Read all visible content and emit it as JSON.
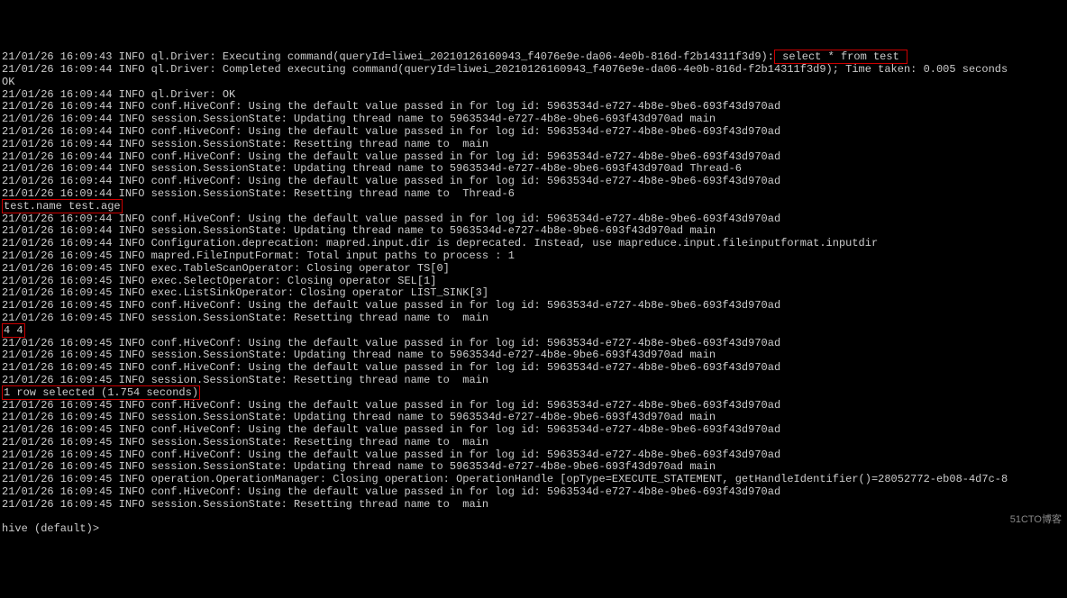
{
  "lines": [
    {
      "type": "mixed",
      "prefix": "21/01/26 16:09:43 INFO ql.Driver: Executing command(queryId=liwei_20210126160943_f4076e9e-da06-4e0b-816d-f2b14311f3d9):",
      "highlighted": " select * from test "
    },
    {
      "type": "plain",
      "text": "21/01/26 16:09:44 INFO ql.Driver: Completed executing command(queryId=liwei_20210126160943_f4076e9e-da06-4e0b-816d-f2b14311f3d9); Time taken: 0.005 seconds"
    },
    {
      "type": "plain",
      "text": "OK"
    },
    {
      "type": "plain",
      "text": "21/01/26 16:09:44 INFO ql.Driver: OK"
    },
    {
      "type": "plain",
      "text": "21/01/26 16:09:44 INFO conf.HiveConf: Using the default value passed in for log id: 5963534d-e727-4b8e-9be6-693f43d970ad"
    },
    {
      "type": "plain",
      "text": "21/01/26 16:09:44 INFO session.SessionState: Updating thread name to 5963534d-e727-4b8e-9be6-693f43d970ad main"
    },
    {
      "type": "plain",
      "text": "21/01/26 16:09:44 INFO conf.HiveConf: Using the default value passed in for log id: 5963534d-e727-4b8e-9be6-693f43d970ad"
    },
    {
      "type": "plain",
      "text": "21/01/26 16:09:44 INFO session.SessionState: Resetting thread name to  main"
    },
    {
      "type": "plain",
      "text": "21/01/26 16:09:44 INFO conf.HiveConf: Using the default value passed in for log id: 5963534d-e727-4b8e-9be6-693f43d970ad"
    },
    {
      "type": "plain",
      "text": "21/01/26 16:09:44 INFO session.SessionState: Updating thread name to 5963534d-e727-4b8e-9be6-693f43d970ad Thread-6"
    },
    {
      "type": "plain",
      "text": "21/01/26 16:09:44 INFO conf.HiveConf: Using the default value passed in for log id: 5963534d-e727-4b8e-9be6-693f43d970ad"
    },
    {
      "type": "plain",
      "text": "21/01/26 16:09:44 INFO session.SessionState: Resetting thread name to  Thread-6"
    },
    {
      "type": "highlighted",
      "text": "test.name test.age"
    },
    {
      "type": "plain",
      "text": "21/01/26 16:09:44 INFO conf.HiveConf: Using the default value passed in for log id: 5963534d-e727-4b8e-9be6-693f43d970ad"
    },
    {
      "type": "plain",
      "text": "21/01/26 16:09:44 INFO session.SessionState: Updating thread name to 5963534d-e727-4b8e-9be6-693f43d970ad main"
    },
    {
      "type": "plain",
      "text": "21/01/26 16:09:44 INFO Configuration.deprecation: mapred.input.dir is deprecated. Instead, use mapreduce.input.fileinputformat.inputdir"
    },
    {
      "type": "plain",
      "text": "21/01/26 16:09:45 INFO mapred.FileInputFormat: Total input paths to process : 1"
    },
    {
      "type": "plain",
      "text": "21/01/26 16:09:45 INFO exec.TableScanOperator: Closing operator TS[0]"
    },
    {
      "type": "plain",
      "text": "21/01/26 16:09:45 INFO exec.SelectOperator: Closing operator SEL[1]"
    },
    {
      "type": "plain",
      "text": "21/01/26 16:09:45 INFO exec.ListSinkOperator: Closing operator LIST_SINK[3]"
    },
    {
      "type": "plain",
      "text": "21/01/26 16:09:45 INFO conf.HiveConf: Using the default value passed in for log id: 5963534d-e727-4b8e-9be6-693f43d970ad"
    },
    {
      "type": "plain",
      "text": "21/01/26 16:09:45 INFO session.SessionState: Resetting thread name to  main"
    },
    {
      "type": "highlighted",
      "text": "4 4"
    },
    {
      "type": "plain",
      "text": "21/01/26 16:09:45 INFO conf.HiveConf: Using the default value passed in for log id: 5963534d-e727-4b8e-9be6-693f43d970ad"
    },
    {
      "type": "plain",
      "text": "21/01/26 16:09:45 INFO session.SessionState: Updating thread name to 5963534d-e727-4b8e-9be6-693f43d970ad main"
    },
    {
      "type": "plain",
      "text": "21/01/26 16:09:45 INFO conf.HiveConf: Using the default value passed in for log id: 5963534d-e727-4b8e-9be6-693f43d970ad"
    },
    {
      "type": "plain",
      "text": "21/01/26 16:09:45 INFO session.SessionState: Resetting thread name to  main"
    },
    {
      "type": "highlighted",
      "text": "1 row selected (1.754 seconds)"
    },
    {
      "type": "plain",
      "text": "21/01/26 16:09:45 INFO conf.HiveConf: Using the default value passed in for log id: 5963534d-e727-4b8e-9be6-693f43d970ad"
    },
    {
      "type": "plain",
      "text": "21/01/26 16:09:45 INFO session.SessionState: Updating thread name to 5963534d-e727-4b8e-9be6-693f43d970ad main"
    },
    {
      "type": "plain",
      "text": "21/01/26 16:09:45 INFO conf.HiveConf: Using the default value passed in for log id: 5963534d-e727-4b8e-9be6-693f43d970ad"
    },
    {
      "type": "plain",
      "text": "21/01/26 16:09:45 INFO session.SessionState: Resetting thread name to  main"
    },
    {
      "type": "plain",
      "text": "21/01/26 16:09:45 INFO conf.HiveConf: Using the default value passed in for log id: 5963534d-e727-4b8e-9be6-693f43d970ad"
    },
    {
      "type": "plain",
      "text": "21/01/26 16:09:45 INFO session.SessionState: Updating thread name to 5963534d-e727-4b8e-9be6-693f43d970ad main"
    },
    {
      "type": "plain",
      "text": "21/01/26 16:09:45 INFO operation.OperationManager: Closing operation: OperationHandle [opType=EXECUTE_STATEMENT, getHandleIdentifier()=28052772-eb08-4d7c-8"
    },
    {
      "type": "plain",
      "text": "21/01/26 16:09:45 INFO conf.HiveConf: Using the default value passed in for log id: 5963534d-e727-4b8e-9be6-693f43d970ad"
    },
    {
      "type": "plain",
      "text": "21/01/26 16:09:45 INFO session.SessionState: Resetting thread name to  main"
    }
  ],
  "prompt": "hive (default)>",
  "watermark": "51CTO博客"
}
